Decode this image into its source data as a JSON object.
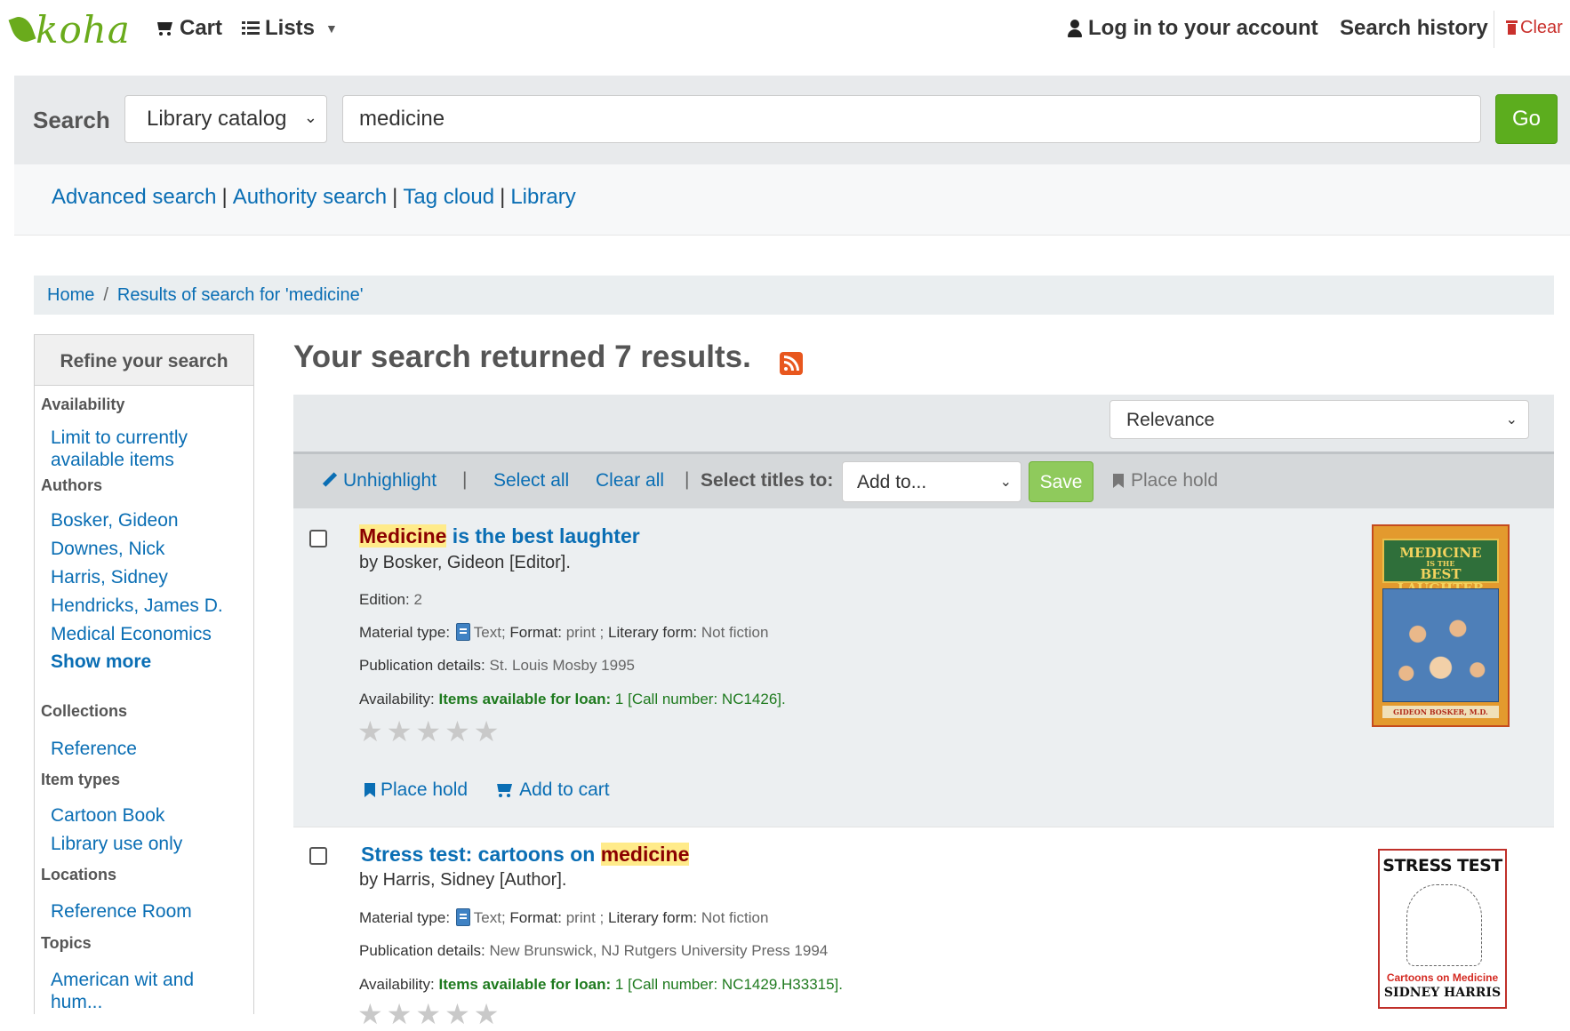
{
  "header": {
    "logo_text": "koha",
    "cart_label": "Cart",
    "lists_label": "Lists",
    "login_label": "Log in to your account",
    "search_history_label": "Search history",
    "clear_label": "Clear"
  },
  "search": {
    "label": "Search",
    "scope_selected": "Library catalog",
    "query": "medicine",
    "go_label": "Go"
  },
  "more_searches": {
    "advanced": "Advanced search",
    "authority": "Authority search",
    "tag_cloud": "Tag cloud",
    "library": "Library",
    "separator": "|"
  },
  "breadcrumb": {
    "home": "Home",
    "current": "Results of search for 'medicine'"
  },
  "sidebar": {
    "heading": "Refine your search",
    "availability_title": "Availability",
    "availability_link": "Limit to currently available items",
    "authors_title": "Authors",
    "authors": [
      "Bosker, Gideon",
      "Downes, Nick",
      "Harris, Sidney",
      "Hendricks, James D.",
      "Medical Economics"
    ],
    "show_more": "Show more",
    "collections_title": "Collections",
    "collections": [
      "Reference"
    ],
    "item_types_title": "Item types",
    "item_types": [
      "Cartoon Book",
      "Library use only"
    ],
    "locations_title": "Locations",
    "locations": [
      "Reference Room"
    ],
    "topics_title": "Topics",
    "topics": [
      "American wit and hum..."
    ]
  },
  "results": {
    "summary": "Your search returned 7 results.",
    "sort_selected": "Relevance",
    "toolbar": {
      "unhighlight": "Unhighlight",
      "select_all": "Select all",
      "clear_all": "Clear all",
      "select_titles_to": "Select titles to:",
      "add_to_selected": "Add to...",
      "save": "Save",
      "place_hold": "Place hold"
    },
    "items": [
      {
        "title_highlight": "Medicine",
        "title_rest": " is the best laughter",
        "author": "by Bosker, Gideon [Editor].",
        "edition_label": "Edition:",
        "edition_value": "2",
        "material_label": "Material type:",
        "material_value": "Text;",
        "format_label": "Format:",
        "format_value": "print ;",
        "literary_label": "Literary form:",
        "literary_value": "Not fiction",
        "pub_label": "Publication details:",
        "pub_value": "St. Louis Mosby 1995",
        "avail_label": "Availability:",
        "avail_status": "Items available for loan:",
        "avail_count": "1",
        "call_number": "[Call number: NC1426].",
        "rating_stars": 0,
        "place_hold": "Place hold",
        "add_to_cart": "Add to cart",
        "cover_title_line1": "MEDICINE",
        "cover_title_line2": "IS THE",
        "cover_title_line3": "BEST LAUGHTER",
        "cover_footer": "GIDEON BOSKER, M.D."
      },
      {
        "title_rest": "Stress test: cartoons on ",
        "title_highlight": "medicine",
        "author": "by Harris, Sidney [Author].",
        "material_label": "Material type:",
        "material_value": "Text;",
        "format_label": "Format:",
        "format_value": "print ;",
        "literary_label": "Literary form:",
        "literary_value": "Not fiction",
        "pub_label": "Publication details:",
        "pub_value": "New Brunswick, NJ Rutgers University Press 1994",
        "avail_label": "Availability:",
        "avail_status": "Items available for loan:",
        "avail_count": "1",
        "call_number": "[Call number: NC1429.H33315].",
        "cover_title": "STRESS TEST",
        "cover_subtitle": "Cartoons on Medicine",
        "cover_author": "SIDNEY HARRIS"
      }
    ]
  },
  "colors": {
    "brand_green": "#6aab1c",
    "link_blue": "#0a6eb4",
    "go_green": "#5cad1e",
    "available_green": "#1e7a1e",
    "highlight": "#ffeb8a",
    "rss_orange": "#e8571e"
  }
}
